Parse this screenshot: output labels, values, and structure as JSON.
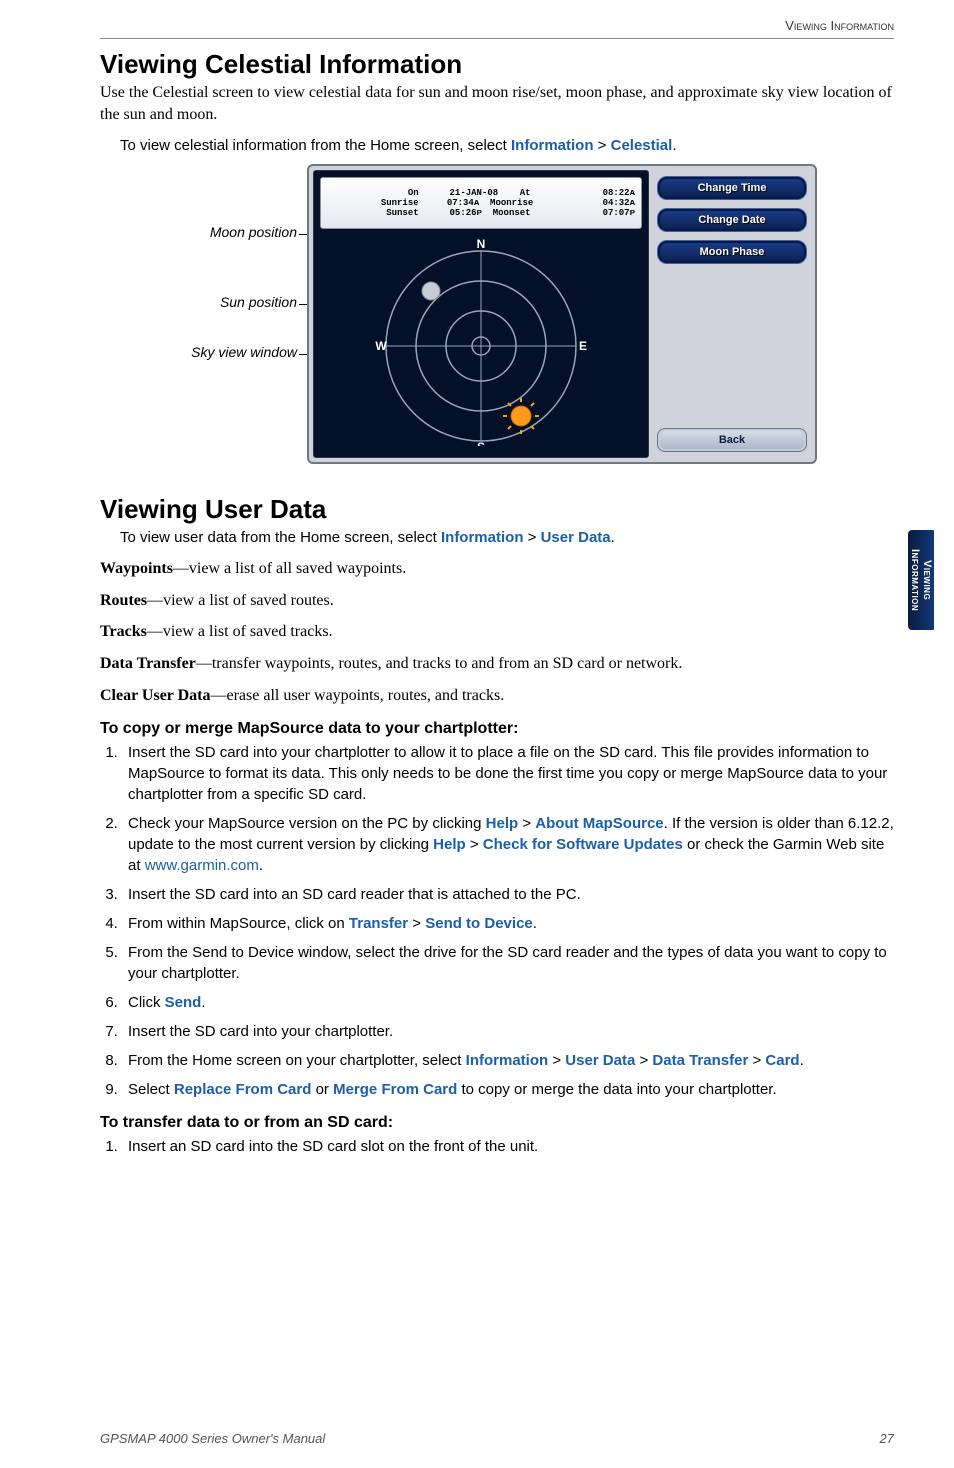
{
  "header": {
    "section": "Viewing Information"
  },
  "sidetab": {
    "line1": "Viewing",
    "line2": "Information"
  },
  "s1": {
    "title": "Viewing Celestial Information",
    "intro": "Use the Celestial screen to view celestial data for sun and moon rise/set, moon phase, and approximate sky view location of the sun and moon.",
    "instr_pre": "To view celestial information from the Home screen, select ",
    "information": "Information",
    "gt1": " > ",
    "celestial": "Celestial",
    "period": "."
  },
  "fig": {
    "callouts": {
      "moon": "Moon position",
      "sun": "Sun position",
      "sky": "Sky view window"
    },
    "info": {
      "on": "On",
      "date": "21-JAN-08",
      "at": "At",
      "attime": "08:22ᴀ",
      "sunrise": "Sunrise",
      "srtime": "07:34ᴀ",
      "moonrise": "Moonrise",
      "mrtime": "04:32ᴀ",
      "sunset": "Sunset",
      "sstime": "05:26ᴘ",
      "moonset": "Moonset",
      "mstime": "07:07ᴘ"
    },
    "btns": {
      "time": "Change Time",
      "date": "Change Date",
      "moon": "Moon Phase",
      "back": "Back"
    },
    "compass": {
      "n": "N",
      "s": "S",
      "e": "E",
      "w": "W"
    }
  },
  "s2": {
    "title": "Viewing User Data",
    "instr_pre": "To view user data from the Home screen, select ",
    "information": "Information",
    "gt1": " > ",
    "userdata": "User Data",
    "period": "."
  },
  "items": {
    "wp_b": "Waypoints",
    "wp_t": "—view a list of all saved waypoints.",
    "rt_b": "Routes",
    "rt_t": "—view a list of saved routes.",
    "tr_b": "Tracks",
    "tr_t": "—view a list of saved tracks.",
    "dt_b": "Data Transfer",
    "dt_t": "—transfer waypoints, routes, and tracks to and from an SD card or network.",
    "cl_b": "Clear User Data",
    "cl_t": "—erase all user waypoints, routes, and tracks."
  },
  "procA": {
    "heading": "To copy or merge MapSource data to your chartplotter:",
    "step1": "Insert the SD card into your chartplotter to allow it to place a file on the SD card. This file provides information to MapSource to format its data. This only needs to be done the first time you copy or merge MapSource data to your chartplotter from a specific SD card.",
    "step2a": "Check your MapSource version on the PC by clicking ",
    "help1": "Help",
    "gtA": " > ",
    "about": "About MapSource",
    "step2b": ". If the version is older than 6.12.2, update to the most current version by clicking ",
    "help2": "Help",
    "gtB": " > ",
    "updates": "Check for Software Updates",
    "step2c": " or check the Garmin Web site at ",
    "url": "www.garmin.com",
    "step2d": ".",
    "step3": "Insert the SD card into an SD card reader that is attached to the PC.",
    "step4a": "From within MapSource, click on ",
    "transfer": "Transfer",
    "gtC": " > ",
    "send": "Send to Device",
    "step4b": ".",
    "step5": "From the Send to Device window, select the drive for the SD card reader and the types of data you want to copy to your chartplotter.",
    "step6a": "Click ",
    "sendbtn": "Send",
    "step6b": ".",
    "step7": "Insert the SD card into your chartplotter.",
    "step8a": "From the Home screen on your chartplotter, select ",
    "info": "Information",
    "gtD": " > ",
    "ud": "User Data",
    "gtE": " > ",
    "dt": "Data Transfer",
    "gtF": " > ",
    "card": "Card",
    "step8b": ".",
    "step9a": "Select ",
    "replace": "Replace From Card",
    "or": " or ",
    "merge": "Merge From Card",
    "step9b": " to copy or merge the data into your chartplotter."
  },
  "procB": {
    "heading": "To transfer data to or from an SD card:",
    "step1": "Insert an SD card into the SD card slot on the front of the unit."
  },
  "footer": {
    "left": "GPSMAP 4000 Series Owner's Manual",
    "right": "27"
  }
}
